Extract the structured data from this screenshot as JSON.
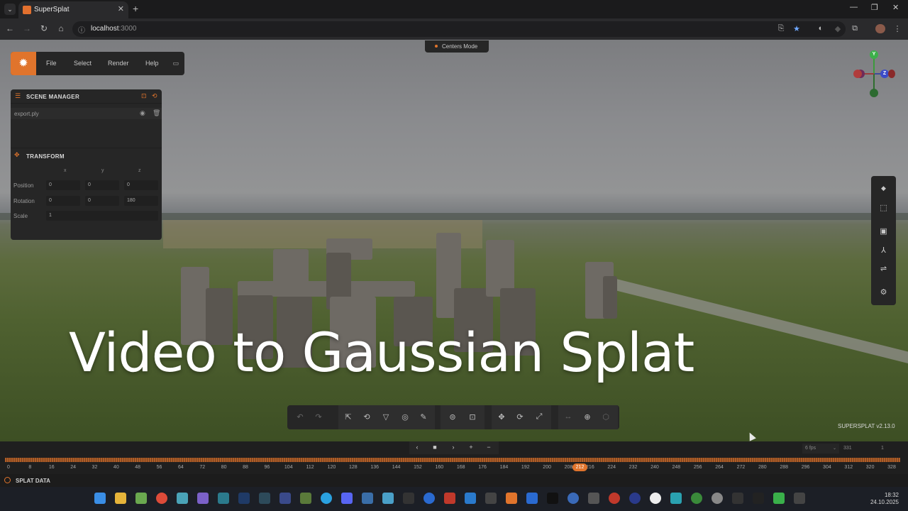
{
  "browser": {
    "tab_title": "SuperSplat",
    "url_host": "localhost",
    "url_port": ":3000"
  },
  "menubar": {
    "items": [
      "File",
      "Select",
      "Render",
      "Help"
    ]
  },
  "mode_pill": {
    "label": "Centers Mode"
  },
  "scene_manager": {
    "title": "SCENE MANAGER",
    "file_name": "export.ply"
  },
  "transform": {
    "title": "TRANSFORM",
    "axes": [
      "x",
      "y",
      "z"
    ],
    "position_label": "Position",
    "position": [
      "0",
      "0",
      "0"
    ],
    "rotation_label": "Rotation",
    "rotation": [
      "0",
      "0",
      "180"
    ],
    "scale_label": "Scale",
    "scale": "1"
  },
  "gizmo": {
    "y": "Y",
    "z": "Z"
  },
  "overlay_title": "Video to Gaussian Splat",
  "version": "SUPERSPLAT v2.13.0",
  "timeline": {
    "fps": "6 fps",
    "frames": "331",
    "key": "1",
    "current_frame": "212",
    "ticks": [
      "0",
      "8",
      "16",
      "24",
      "32",
      "40",
      "48",
      "56",
      "64",
      "72",
      "80",
      "88",
      "96",
      "104",
      "112",
      "120",
      "128",
      "136",
      "144",
      "152",
      "160",
      "168",
      "176",
      "184",
      "192",
      "200",
      "208",
      "216",
      "224",
      "232",
      "240",
      "248",
      "256",
      "264",
      "272",
      "280",
      "288",
      "296",
      "304",
      "312",
      "320",
      "328"
    ]
  },
  "splat_data": {
    "label": "SPLAT DATA"
  },
  "taskbar": {
    "time": "18:32",
    "date": "24.10.2025"
  },
  "colors": {
    "accent": "#e0742c",
    "panel": "#262626"
  }
}
